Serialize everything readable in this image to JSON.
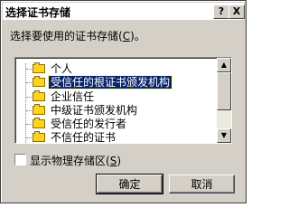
{
  "window": {
    "title": "选择证书存储",
    "help_label": "?",
    "close_label": "X"
  },
  "prompt": {
    "text": "选择要使用的证书存储(",
    "accel": "C",
    "suffix": ")。"
  },
  "store_list": {
    "items": [
      {
        "label": "个人",
        "icon": "folder-icon",
        "selected": false
      },
      {
        "label": "受信任的根证书颁发机构",
        "icon": "folder-icon",
        "selected": true
      },
      {
        "label": "企业信任",
        "icon": "folder-icon",
        "selected": false
      },
      {
        "label": "中级证书颁发机构",
        "icon": "folder-icon",
        "selected": false
      },
      {
        "label": "受信任的发行者",
        "icon": "folder-icon",
        "selected": false
      },
      {
        "label": "不信任的证书",
        "icon": "folder-icon",
        "selected": false
      }
    ],
    "scroll_up": "▲",
    "scroll_down": "▼"
  },
  "show_physical": {
    "text": "显示物理存储区(",
    "accel": "S",
    "suffix": ")",
    "checked": false
  },
  "buttons": {
    "ok": "确定",
    "cancel": "取消"
  },
  "colors": {
    "face": "#d4d0c8",
    "selection": "#0a246a",
    "folder": "#ffd21e"
  }
}
